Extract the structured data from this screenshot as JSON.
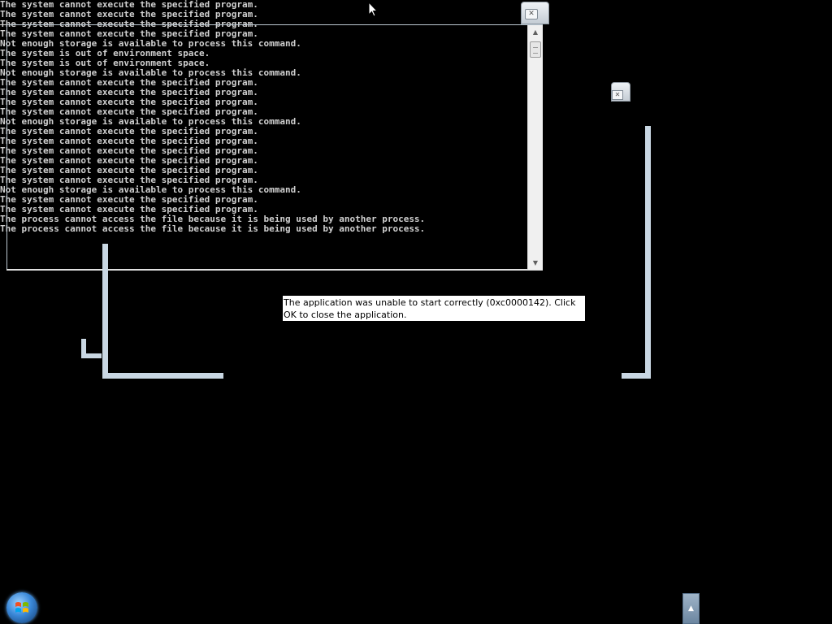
{
  "console": {
    "lines": [
      "The system cannot execute the specified program.",
      "The system cannot execute the specified program.",
      "The system cannot execute the specified program.",
      "The system cannot execute the specified program.",
      "Not enough storage is available to process this command.",
      "The system is out of environment space.",
      "The system is out of environment space.",
      "Not enough storage is available to process this command.",
      "The system cannot execute the specified program.",
      "The system cannot execute the specified program.",
      "The system cannot execute the specified program.",
      "The system cannot execute the specified program.",
      "Not enough storage is available to process this command.",
      "The system cannot execute the specified program.",
      "The system cannot execute the specified program.",
      "The system cannot execute the specified program.",
      "The system cannot execute the specified program.",
      "The system cannot execute the specified program.",
      "The system cannot execute the specified program.",
      "Not enough storage is available to process this command.",
      "The system cannot execute the specified program.",
      "The system cannot execute the specified program.",
      "The process cannot access the file because it is being used by another process.",
      "The process cannot access the file because it is being used by another process."
    ],
    "scroll_up_icon": "scroll-up-arrow",
    "scroll_down_icon": "scroll-down-arrow"
  },
  "error": {
    "message": "The application was unable to start correctly (0xc0000142). Click OK to close the application."
  },
  "icons": {
    "close": "close-icon",
    "start": "windows-logo-icon",
    "tray": "chevron-up-icon",
    "cursor": "mouse-pointer-icon"
  },
  "colors": {
    "desktop": "#000000",
    "console_text": "#d0d0d0",
    "window_frame": "#c9d7e3"
  }
}
